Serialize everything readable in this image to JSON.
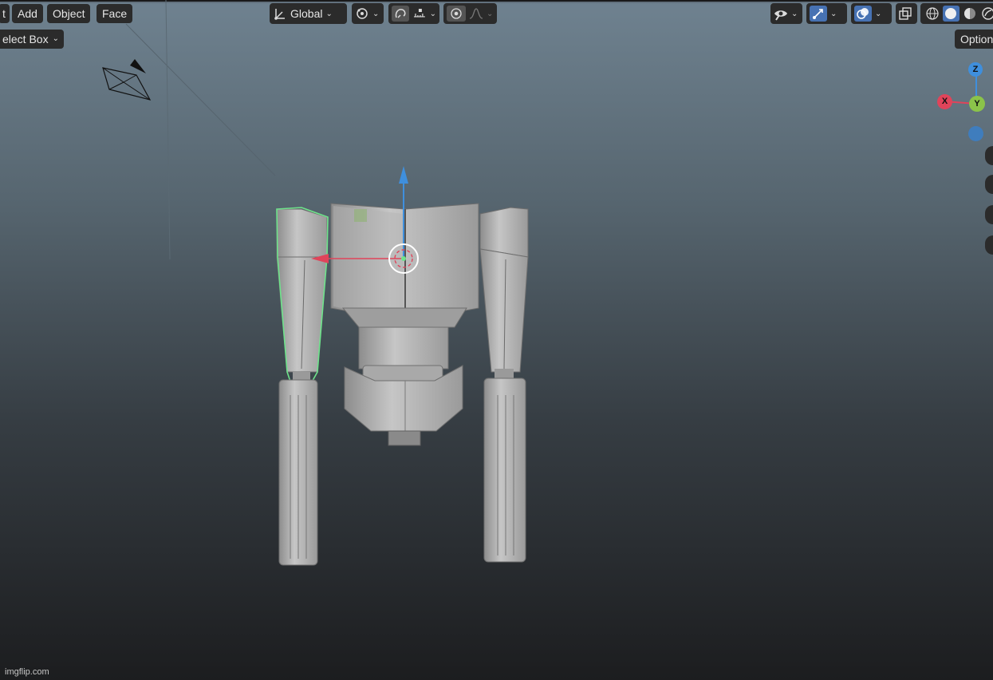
{
  "header": {
    "cut_menu": "t",
    "menus": [
      {
        "label": "Add"
      },
      {
        "label": "Object"
      },
      {
        "label": "Face"
      }
    ],
    "select_mode": "elect Box",
    "transform_orientation": "Global",
    "options_label": "Option"
  },
  "gizmo": {
    "z": "Z",
    "x": "X",
    "y": "Y"
  },
  "footer": {
    "watermark": "imgflip.com"
  },
  "icons": [
    "transform-orientation-icon",
    "pivot-point-icon",
    "snap-icon",
    "snap-increment-icon",
    "proportional-edit-icon",
    "falloff-curve-icon",
    "visibility-eye-icon",
    "gizmo-toggle-icon",
    "overlay-toggle-icon",
    "xray-toggle-icon",
    "shading-wireframe-icon",
    "shading-solid-icon",
    "shading-material-icon",
    "shading-rendered-icon",
    "camera-object-icon",
    "move-axis-x-icon",
    "move-axis-z-icon",
    "object-origin-icon"
  ],
  "colors": {
    "accent_blue": "#4772b3",
    "selection_outline": "#6ee38b",
    "axis_x": "#e0445a",
    "axis_y": "#8bc34a",
    "axis_z": "#3f8fdd"
  }
}
